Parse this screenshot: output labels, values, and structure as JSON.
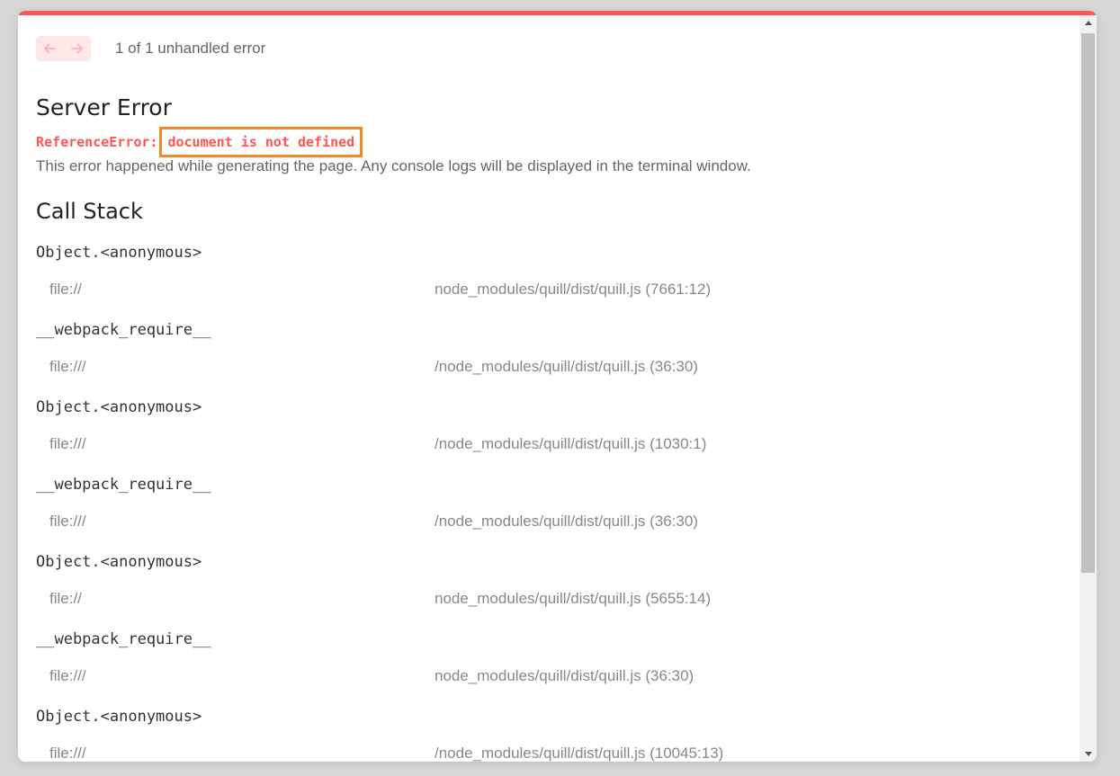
{
  "nav": {
    "prev_icon": "arrow-left-icon",
    "next_icon": "arrow-right-icon",
    "count_text": "1 of 1 unhandled error"
  },
  "error": {
    "title": "Server Error",
    "type": "ReferenceError:",
    "message": "document is not defined",
    "description": "This error happened while generating the page. Any console logs will be displayed in the terminal window."
  },
  "call_stack": {
    "title": "Call Stack",
    "frames": [
      {
        "fn": "Object.<anonymous>",
        "loc_prefix": "file://",
        "loc_path": "node_modules/quill/dist/quill.js (7661:12)"
      },
      {
        "fn": "__webpack_require__",
        "loc_prefix": "file:///",
        "loc_path": "/node_modules/quill/dist/quill.js (36:30)"
      },
      {
        "fn": "Object.<anonymous>",
        "loc_prefix": "file:///",
        "loc_path": "/node_modules/quill/dist/quill.js (1030:1)"
      },
      {
        "fn": "__webpack_require__",
        "loc_prefix": "file:///",
        "loc_path": "/node_modules/quill/dist/quill.js (36:30)"
      },
      {
        "fn": "Object.<anonymous>",
        "loc_prefix": "file://",
        "loc_path": "node_modules/quill/dist/quill.js (5655:14)"
      },
      {
        "fn": "__webpack_require__",
        "loc_prefix": "file:///",
        "loc_path": "node_modules/quill/dist/quill.js (36:30)"
      },
      {
        "fn": "Object.<anonymous>",
        "loc_prefix": "file:///",
        "loc_path": "/node_modules/quill/dist/quill.js (10045:13)"
      }
    ]
  },
  "colors": {
    "accent": "#ff5555",
    "highlight_border": "#f08a24",
    "nav_bg": "#fde7e7"
  }
}
